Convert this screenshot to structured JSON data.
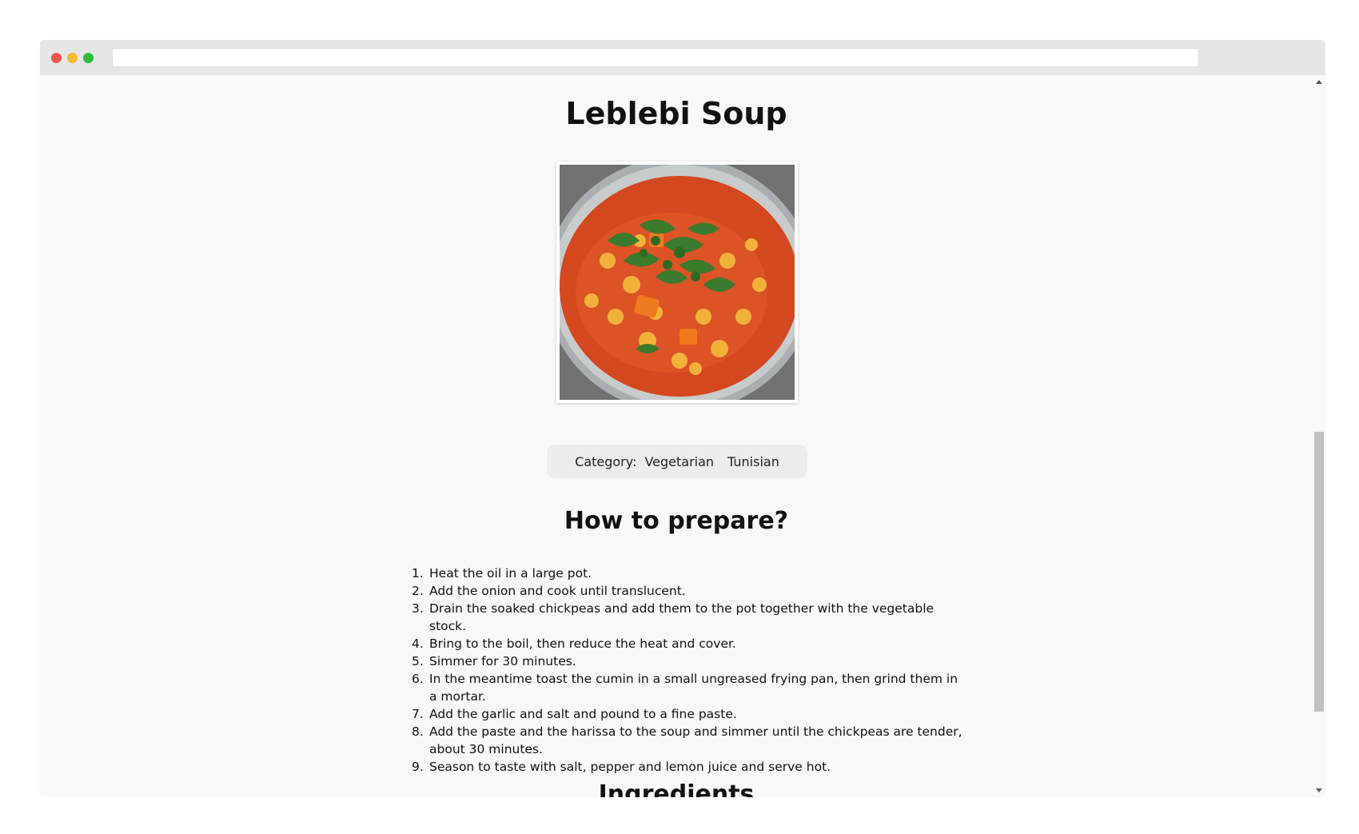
{
  "recipe": {
    "title": "Leblebi Soup",
    "image_alt": "Leblebi Soup",
    "category_label": "Category:",
    "category": "Vegetarian",
    "area": "Tunisian"
  },
  "instructions": {
    "heading": "How to prepare?",
    "steps": [
      {
        "num": "1.",
        "text": "Heat the oil in a large pot."
      },
      {
        "num": "2.",
        "text": "Add the onion and cook until translucent."
      },
      {
        "num": "3.",
        "text": "Drain the soaked chickpeas and add them to the pot together with the vegetable stock."
      },
      {
        "num": "4.",
        "text": "Bring to the boil, then reduce the heat and cover."
      },
      {
        "num": "5.",
        "text": "Simmer for 30 minutes."
      },
      {
        "num": "6.",
        "text": "In the meantime toast the cumin in a small ungreased frying pan, then grind them in a mortar."
      },
      {
        "num": "7.",
        "text": "Add the garlic and salt and pound to a fine paste."
      },
      {
        "num": "8.",
        "text": "Add the paste and the harissa to the soup and simmer until the chickpeas are tender, about 30 minutes."
      },
      {
        "num": "9.",
        "text": "Season to taste with salt, pepper and lemon juice and serve hot."
      }
    ]
  },
  "ingredients": {
    "heading": "Ingredients"
  },
  "colors": {
    "background": "#f8f8f8",
    "soup_red": "#d9451f",
    "herb_green": "#3c7a2e"
  }
}
